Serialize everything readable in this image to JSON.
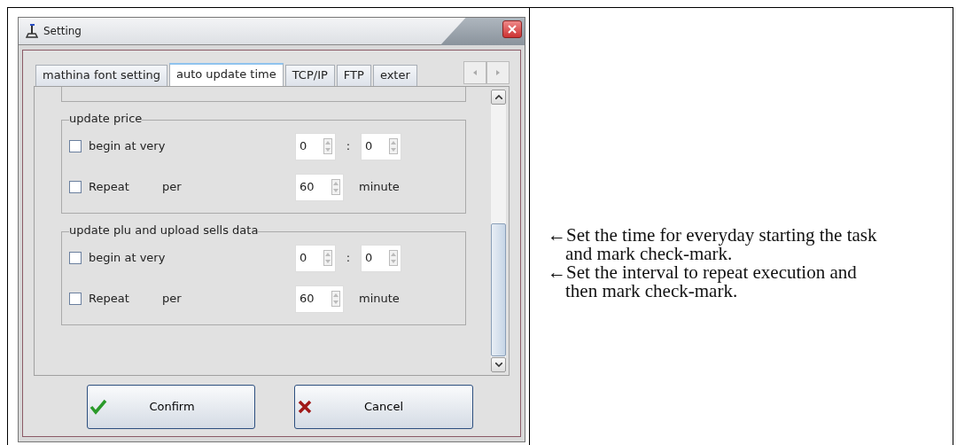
{
  "window": {
    "title": "Setting"
  },
  "tabs": [
    {
      "label": "mathina font setting",
      "selected": false
    },
    {
      "label": "auto update time",
      "selected": true
    },
    {
      "label": "TCP/IP",
      "selected": false
    },
    {
      "label": "FTP",
      "selected": false
    },
    {
      "label": "exter",
      "selected": false
    }
  ],
  "groups": [
    {
      "title": "update price",
      "rows": [
        {
          "kind": "time",
          "label": "begin at very",
          "checked": false,
          "hour": "0",
          "separator": ":",
          "minute": "0"
        },
        {
          "kind": "repeat",
          "label": "Repeat",
          "prefix": "per",
          "value": "60",
          "unit": "minute",
          "checked": false
        }
      ]
    },
    {
      "title": "update plu and upload sells data",
      "rows": [
        {
          "kind": "time",
          "label": "begin at very",
          "checked": false,
          "hour": "0",
          "separator": ":",
          "minute": "0"
        },
        {
          "kind": "repeat",
          "label": "Repeat",
          "prefix": "per",
          "value": "60",
          "unit": "minute",
          "checked": false
        }
      ]
    }
  ],
  "buttons": [
    {
      "kind": "confirm",
      "label": "Confirm"
    },
    {
      "kind": "cancel",
      "label": "Cancel"
    }
  ],
  "notes": [
    "←Set the time for everyday starting the task and mark check-mark.",
    "←Set the interval to repeat execution and then mark check-mark."
  ]
}
